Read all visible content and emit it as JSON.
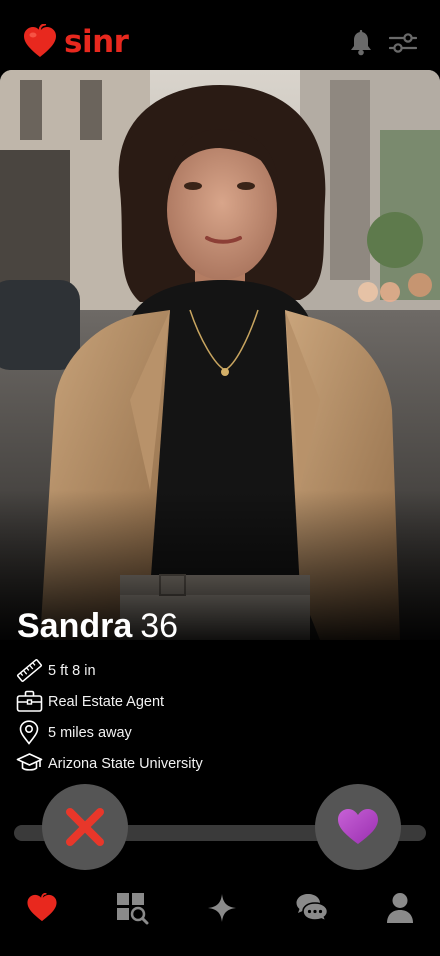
{
  "header": {
    "app_name": "sinr",
    "brand_color": "#e8281e",
    "icons": [
      "heart-logo-icon",
      "bell-icon",
      "filters-icon"
    ]
  },
  "profile": {
    "name": "Sandra",
    "age": "36",
    "details": [
      {
        "icon": "ruler-icon",
        "text": "5 ft 8 in"
      },
      {
        "icon": "briefcase-icon",
        "text": "Real Estate Agent"
      },
      {
        "icon": "location-pin-icon",
        "text": "5 miles away"
      },
      {
        "icon": "graduation-cap-icon",
        "text": "Arizona State University"
      }
    ]
  },
  "actions": {
    "pass_icon": "x-icon",
    "like_icon": "heart-icon",
    "pass_color": "#e8372a",
    "like_color": "#b548c6"
  },
  "nav": {
    "items": [
      "heart-icon",
      "explore-icon",
      "sparkle-icon",
      "chat-icon",
      "profile-icon"
    ],
    "active_color": "#e8281e",
    "inactive_color": "#8a8a8a"
  }
}
